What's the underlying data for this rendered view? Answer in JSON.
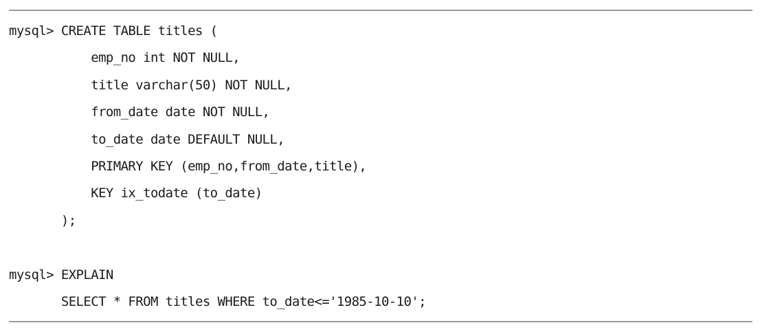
{
  "code": {
    "create_statement": {
      "prompt": "mysql> ",
      "lines": [
        "CREATE TABLE titles (",
        "    emp_no int NOT NULL,",
        "    title varchar(50) NOT NULL,",
        "    from_date date NOT NULL,",
        "    to_date date DEFAULT NULL,",
        "    PRIMARY KEY (emp_no,from_date,title),",
        "    KEY ix_todate (to_date)",
        "       );"
      ]
    },
    "explain_statement": {
      "prompt": "mysql> ",
      "lines": [
        "EXPLAIN",
        "       SELECT * FROM titles WHERE to_date<='1985-10-10';"
      ]
    }
  }
}
